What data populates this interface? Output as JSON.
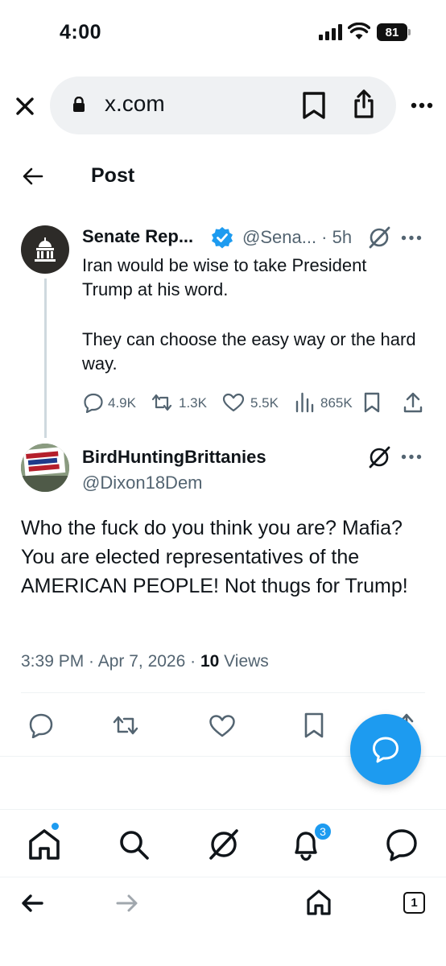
{
  "status_bar": {
    "time": "4:00",
    "battery": "81"
  },
  "browser": {
    "url": "x.com"
  },
  "header": {
    "title": "Post"
  },
  "parent_tweet": {
    "display_name": "Senate Rep...",
    "handle_time": "@Sena... · 5h",
    "text_line1": "Iran would be wise to take President Trump at his word.",
    "text_line2": "They can choose the easy way or the hard way.",
    "replies": "4.9K",
    "reposts": "1.3K",
    "likes": "5.5K",
    "views": "865K"
  },
  "reply_tweet": {
    "display_name": "BirdHuntingBrittanies",
    "handle": "@Dixon18Dem",
    "avatar_sign_lines": [
      "AMERICA WILL",
      "BE TRUMP'S",
      "BANKRUPTCY"
    ],
    "text": "Who the fuck do you think you are? Mafia? You are elected representatives of the AMERICAN PEOPLE!  Not thugs for Trump!",
    "time_date": "3:39 PM · Apr 7, 2026 · ",
    "views_count": "10",
    "views_label": " Views"
  },
  "bottom_nav": {
    "notification_count": "3"
  },
  "browser_toolbar": {
    "tab_count": "1"
  },
  "colors": {
    "accent": "#1d9bf0",
    "secondary_text": "#536471",
    "primary_text": "#0f1419"
  }
}
